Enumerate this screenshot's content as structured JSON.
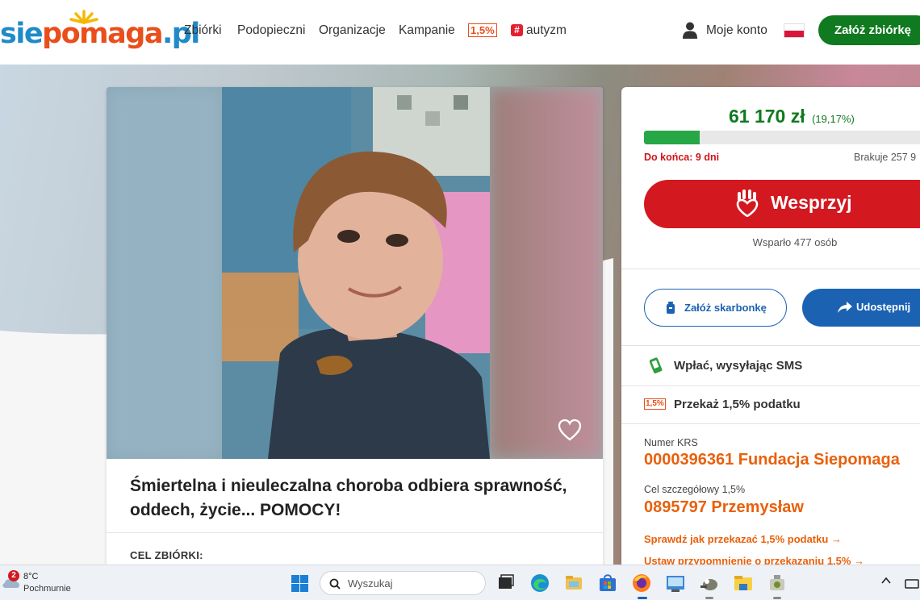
{
  "brand": {
    "logo_part1": "sie",
    "logo_part2": "pomaga",
    "logo_part3": ".pl"
  },
  "nav": {
    "items": [
      "Zbiórki",
      "Podopieczni",
      "Organizacje",
      "Kampanie"
    ],
    "badge": "1,5%",
    "tag_symbol": "#",
    "tag_label": "autyzm",
    "account_label": "Moje konto",
    "create_button": "Załóż zbiórkę"
  },
  "campaign": {
    "title": "Śmiertelna i nieuleczalna choroba odbiera sprawność, oddech, życie... POMOCY!",
    "goal_section_label": "CEL ZBIÓRKI:"
  },
  "donation": {
    "amount": "61 170 zł",
    "percent_label": "(19,17%)",
    "progress_fraction": 0.1917,
    "deadline": "Do końca: 9 dni",
    "missing": "Brakuje 257 9",
    "support_button": "Wesprzyj",
    "supporters": "Wsparło 477 osób",
    "piggy_button": "Załóż skarbonkę",
    "share_button": "Udostępnij",
    "sms_label": "Wpłać, wysyłając SMS",
    "tax_badge": "1,5%",
    "tax_label": "Przekaż 1,5% podatku",
    "krs_label": "Numer KRS",
    "krs_value": "0000396361 Fundacja Siepomaga",
    "goal_label": "Cel szczegółowy 1,5%",
    "goal_value": "0895797 Przemysław",
    "link_how": "Sprawdź jak przekazać 1,5% podatku →",
    "link_remind": "Ustaw przypomnienie o przekazaniu 1,5% →"
  },
  "taskbar": {
    "weather_badge": "2",
    "temperature": "8°C",
    "weather_desc": "Pochmurnie",
    "search_placeholder": "Wyszukaj"
  },
  "colors": {
    "brand_green": "#0f7a1f",
    "support_red": "#d3181f",
    "share_blue": "#1b62b3",
    "accent_orange": "#e9600c"
  }
}
